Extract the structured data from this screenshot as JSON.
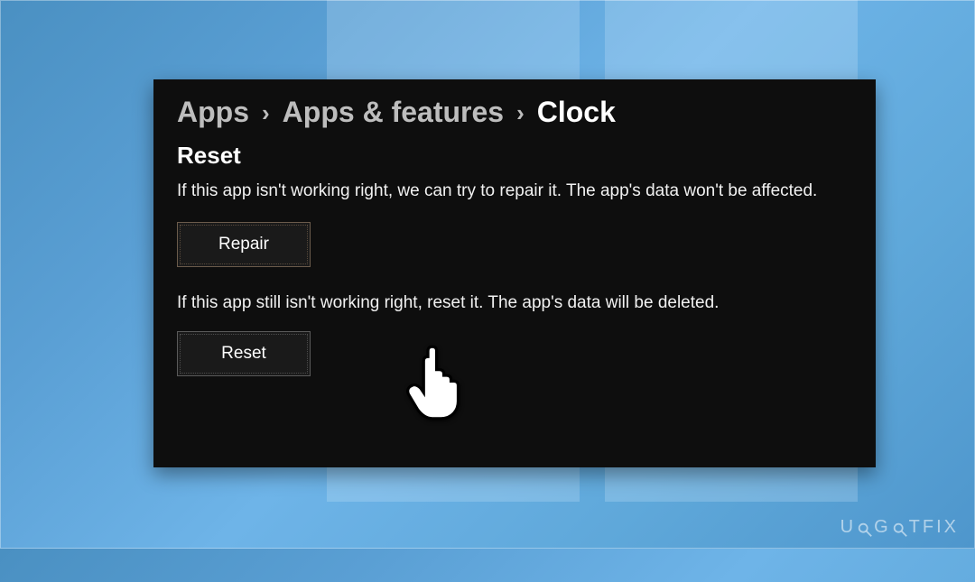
{
  "breadcrumb": {
    "item1": "Apps",
    "item2": "Apps & features",
    "current": "Clock"
  },
  "section": {
    "title": "Reset",
    "repair_desc": "If this app isn't working right, we can try to repair it. The app's data won't be affected.",
    "repair_button": "Repair",
    "reset_desc": "If this app still isn't working right, reset it. The app's data will be deleted.",
    "reset_button": "Reset"
  },
  "watermark": {
    "prefix": "U",
    "mid": "G",
    "suffix": "TFIX"
  }
}
